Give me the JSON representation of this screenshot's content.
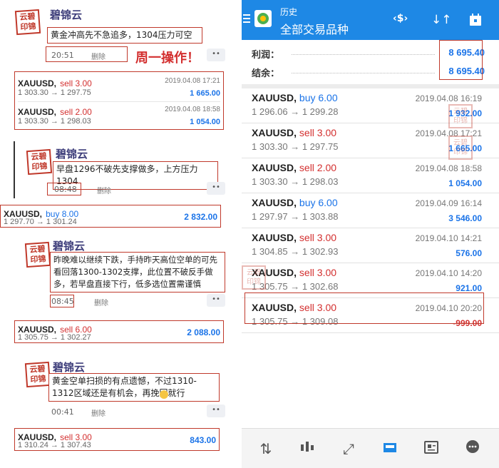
{
  "chat": {
    "sender": "碧锦云",
    "seal_text": "云碧印锦",
    "more": "••",
    "delete": "删除",
    "messages": [
      {
        "text": "黄金冲高先不急追多，1304压力可空",
        "time": "20:51"
      },
      {
        "text": "早盘1296不破先支撑做多，上方压力1304",
        "time": "08:48"
      },
      {
        "text": "昨晚难以继续下跌，手持昨天高位空单的可先看回落1300-1302支撑，此位置不破反手做多，若早盘直接下行，低多选位置需谨慎",
        "time": "08:45"
      },
      {
        "text": "黄金空单扫损的有点遗憾，不过1310-1312区域还是有机会，再挽回就行",
        "time": "00:41"
      }
    ],
    "annotation": "周一操作！",
    "cards": [
      {
        "symbol": "XAUUSD,",
        "side": "sell 3.00",
        "prices": "1 303.30 → 1 297.75",
        "date": "2019.04.08 17:21",
        "profit": "1 665.00"
      },
      {
        "symbol": "XAUUSD,",
        "side": "sell 2.00",
        "prices": "1 303.30 → 1 298.03",
        "date": "2019.04.08 18:58",
        "profit": "1 054.00"
      },
      {
        "symbol": "XAUUSD,",
        "side": "buy 8.00",
        "prices": "1 297.70 → 1 301.24",
        "date": "",
        "profit": "2 832.00"
      },
      {
        "symbol": "XAUUSD,",
        "side": "sell 6.00",
        "prices": "1 305.75 → 1 302.27",
        "date": "",
        "profit": "2 088.00"
      },
      {
        "symbol": "XAUUSD,",
        "side": "sell 3.00",
        "prices": "1 310.24 → 1 307.43",
        "date": "",
        "profit": "843.00"
      }
    ]
  },
  "app": {
    "title": "历史",
    "subtitle": "全部交易品种",
    "summary": {
      "profit_label": "利润：",
      "profit_value": "8 695.40",
      "balance_label": "结余：",
      "balance_value": "8 695.40"
    },
    "watermark": "云碧印锦",
    "trades": [
      {
        "symbol": "XAUUSD,",
        "side": "buy 6.00",
        "prices": "1 296.06 → 1 299.28",
        "date": "2019.04.08 16:19",
        "profit": "1 932.00"
      },
      {
        "symbol": "XAUUSD,",
        "side": "sell 3.00",
        "prices": "1 303.30 → 1 297.75",
        "date": "2019.04.08 17:21",
        "profit": "1 665.00"
      },
      {
        "symbol": "XAUUSD,",
        "side": "sell 2.00",
        "prices": "1 303.30 → 1 298.03",
        "date": "2019.04.08 18:58",
        "profit": "1 054.00"
      },
      {
        "symbol": "XAUUSD,",
        "side": "buy 6.00",
        "prices": "1 297.97 → 1 303.88",
        "date": "2019.04.09 16:14",
        "profit": "3 546.00"
      },
      {
        "symbol": "XAUUSD,",
        "side": "sell 3.00",
        "prices": "1 304.85 → 1 302.93",
        "date": "2019.04.10 14:21",
        "profit": "576.00"
      },
      {
        "symbol": "XAUUSD,",
        "side": "sell 3.00",
        "prices": "1 305.75 → 1 302.68",
        "date": "2019.04.10 14:20",
        "profit": "921.00"
      },
      {
        "symbol": "XAUUSD,",
        "side": "sell 3.00",
        "prices": "1 305.75 → 1 309.08",
        "date": "2019.04.10 20:20",
        "profit": "-999.00"
      }
    ],
    "colors": {
      "topbar": "#1e88e5",
      "buy": "#1a73e8",
      "sell": "#d32f2f",
      "highlight_box": "#c0392b"
    },
    "toolbar_icons": [
      "currency-exchange-icon",
      "sort-icon",
      "calendar-icon"
    ],
    "nav_icons": [
      "quotes-icon",
      "chart-icon",
      "trade-icon",
      "history-icon",
      "news-icon",
      "chat-icon"
    ]
  }
}
